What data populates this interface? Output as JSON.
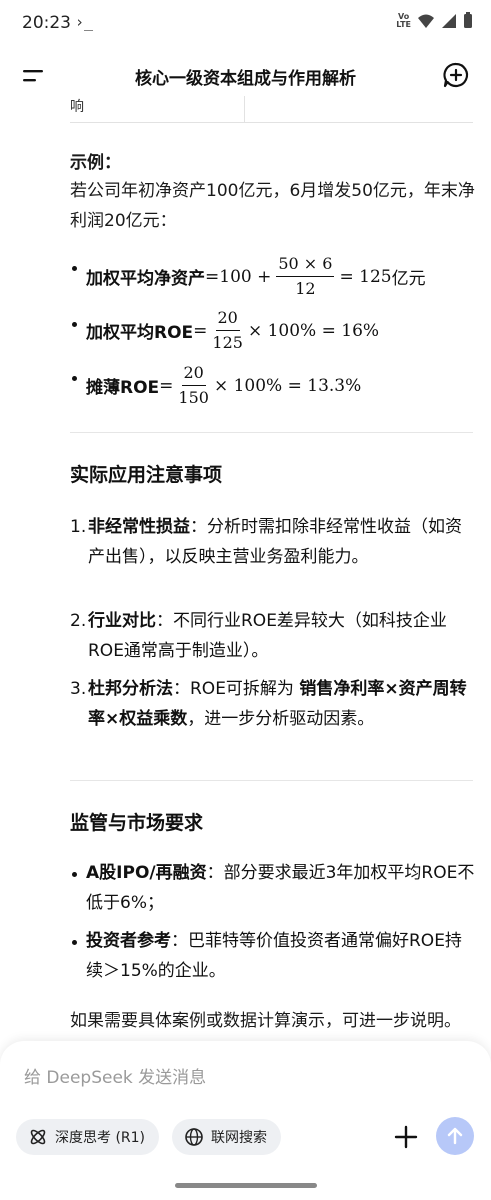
{
  "status": {
    "time": "20:23",
    "term_glyph": "›_",
    "net_top": "Vo",
    "net_bottom": "LTE"
  },
  "appbar": {
    "title": "核心一级资本组成与作用解析"
  },
  "table_fragment": {
    "cell": "响"
  },
  "example": {
    "label": "示例",
    "colon": "：",
    "text": "若公司年初净资产100亿元，6月增发50亿元，年末净利润20亿元："
  },
  "formulas": [
    {
      "label": "加权平均净资产",
      "eq": " = ",
      "lead": "100 + ",
      "num": "50 × 6",
      "den": "12",
      "tail": "= 125",
      "unit": "亿元"
    },
    {
      "label": "加权平均ROE",
      "eq": " = ",
      "num": "20",
      "den": "125",
      "tail": "× 100% = 16%"
    },
    {
      "label": "摊薄ROE",
      "eq": " = ",
      "num": "20",
      "den": "150",
      "tail": "× 100% = 13.3%"
    }
  ],
  "section1": {
    "heading": "实际应用注意事项",
    "items": [
      {
        "n": "1.",
        "bold": "非经常性损益",
        "text": "：分析时需扣除非经常性收益（如资产出售），以反映主营业务盈利能力。"
      },
      {
        "n": "2.",
        "bold": "行业对比",
        "text": "：不同行业ROE差异较大（如科技企业ROE通常高于制造业）。"
      },
      {
        "n": "3.",
        "bold": "杜邦分析法",
        "text": "：ROE可拆解为 ",
        "bold2": "销售净利率×资产周转率×权益乘数",
        "text2": "，进一步分析驱动因素。"
      }
    ]
  },
  "section2": {
    "heading": "监管与市场要求",
    "items": [
      {
        "bold": "A股IPO/再融资",
        "text": "：部分要求最近3年加权平均ROE不低于6%；"
      },
      {
        "bold": "投资者参考",
        "text": "：巴菲特等价值投资者通常偏好ROE持续＞15%的企业。"
      }
    ]
  },
  "footer_text": "如果需要具体案例或数据计算演示，可进一步说明。",
  "input": {
    "placeholder": "给 DeepSeek 发送消息",
    "deepthink_label": "深度思考 (R1)",
    "search_label": "联网搜索"
  },
  "colors": {
    "accent": "#b7c8f8",
    "pill_bg": "#eef0f3"
  }
}
